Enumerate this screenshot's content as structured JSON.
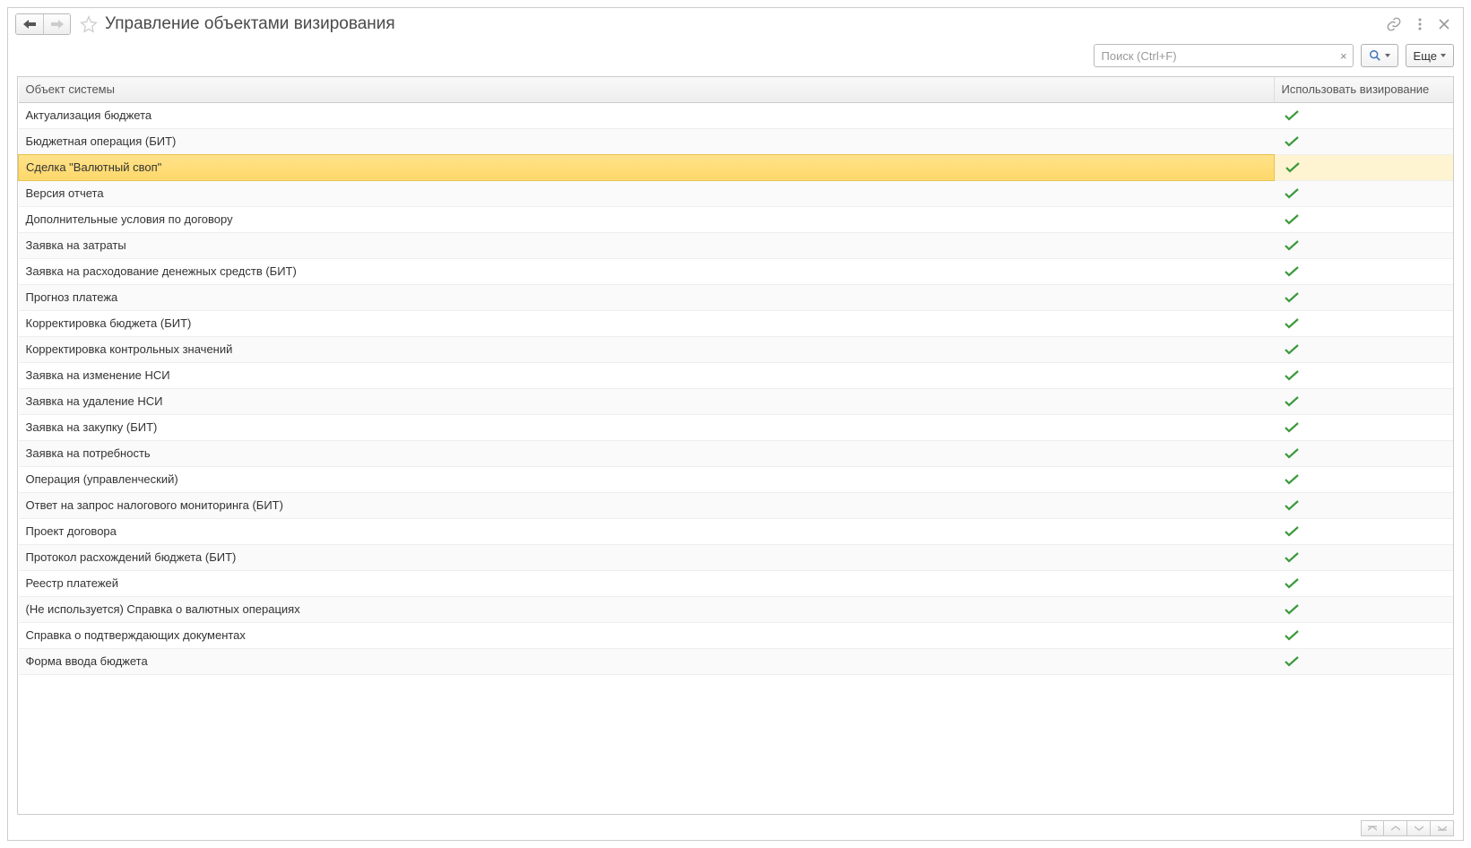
{
  "titlebar": {
    "title": "Управление объектами визирования"
  },
  "toolbar": {
    "search_placeholder": "Поиск (Ctrl+F)",
    "more_label": "Еще"
  },
  "table": {
    "col_object": "Объект системы",
    "col_use": "Использовать визирование",
    "rows": [
      {
        "name": "Актуализация бюджета",
        "checked": true,
        "selected": false
      },
      {
        "name": "Бюджетная операция (БИТ)",
        "checked": true,
        "selected": false
      },
      {
        "name": "Сделка \"Валютный своп\"",
        "checked": true,
        "selected": true
      },
      {
        "name": "Версия отчета",
        "checked": true,
        "selected": false
      },
      {
        "name": "Дополнительные условия по договору",
        "checked": true,
        "selected": false
      },
      {
        "name": "Заявка на затраты",
        "checked": true,
        "selected": false
      },
      {
        "name": "Заявка на расходование денежных средств (БИТ)",
        "checked": true,
        "selected": false
      },
      {
        "name": "Прогноз платежа",
        "checked": true,
        "selected": false
      },
      {
        "name": "Корректировка бюджета (БИТ)",
        "checked": true,
        "selected": false
      },
      {
        "name": "Корректировка контрольных значений",
        "checked": true,
        "selected": false
      },
      {
        "name": "Заявка на изменение НСИ",
        "checked": true,
        "selected": false
      },
      {
        "name": "Заявка на удаление НСИ",
        "checked": true,
        "selected": false
      },
      {
        "name": "Заявка на закупку (БИТ)",
        "checked": true,
        "selected": false
      },
      {
        "name": "Заявка на потребность",
        "checked": true,
        "selected": false
      },
      {
        "name": "Операция (управленческий)",
        "checked": true,
        "selected": false
      },
      {
        "name": "Ответ на запрос налогового мониторинга (БИТ)",
        "checked": true,
        "selected": false
      },
      {
        "name": "Проект договора",
        "checked": true,
        "selected": false
      },
      {
        "name": "Протокол расхождений бюджета (БИТ)",
        "checked": true,
        "selected": false
      },
      {
        "name": "Реестр платежей",
        "checked": true,
        "selected": false
      },
      {
        "name": "(Не используется) Справка о валютных операциях",
        "checked": true,
        "selected": false
      },
      {
        "name": "Справка о подтверждающих документах",
        "checked": true,
        "selected": false
      },
      {
        "name": "Форма ввода бюджета",
        "checked": true,
        "selected": false
      }
    ]
  }
}
